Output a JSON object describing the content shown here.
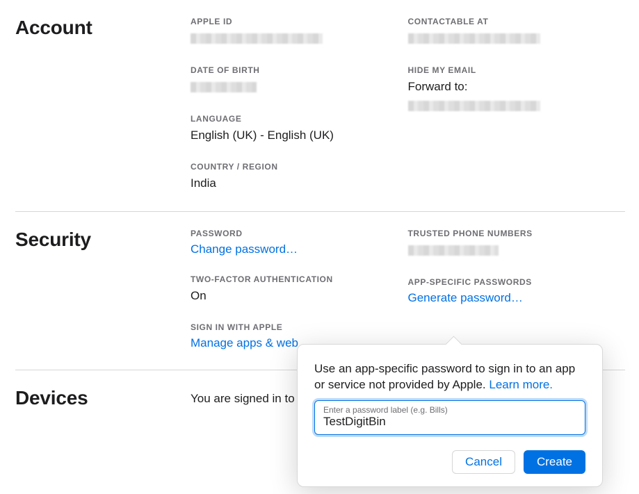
{
  "sections": {
    "account": {
      "title": "Account",
      "apple_id": {
        "label": "APPLE ID"
      },
      "contactable": {
        "label": "CONTACTABLE AT"
      },
      "dob": {
        "label": "DATE OF BIRTH"
      },
      "hide_email": {
        "label": "HIDE MY EMAIL",
        "forward_to": "Forward to:"
      },
      "language": {
        "label": "LANGUAGE",
        "value": "English (UK) - English (UK)"
      },
      "country": {
        "label": "COUNTRY / REGION",
        "value": "India"
      }
    },
    "security": {
      "title": "Security",
      "password": {
        "label": "PASSWORD",
        "change_link": "Change password…"
      },
      "trusted": {
        "label": "TRUSTED PHONE NUMBERS"
      },
      "twofactor": {
        "label": "TWO-FACTOR AUTHENTICATION",
        "value": "On"
      },
      "asp": {
        "label": "APP-SPECIFIC PASSWORDS",
        "generate_link": "Generate password…"
      },
      "siwa": {
        "label": "SIGN IN WITH APPLE",
        "manage_link": "Manage apps & web"
      }
    },
    "devices": {
      "title": "Devices",
      "signed_text": "You are signed in to"
    }
  },
  "popover": {
    "body_prefix": "Use an app-specific password to sign in to an app or service not provided by Apple. ",
    "learn_more": "Learn more.",
    "input_label": "Enter a password label (e.g. Bills)",
    "input_value": "TestDigitBin",
    "cancel": "Cancel",
    "create": "Create"
  }
}
